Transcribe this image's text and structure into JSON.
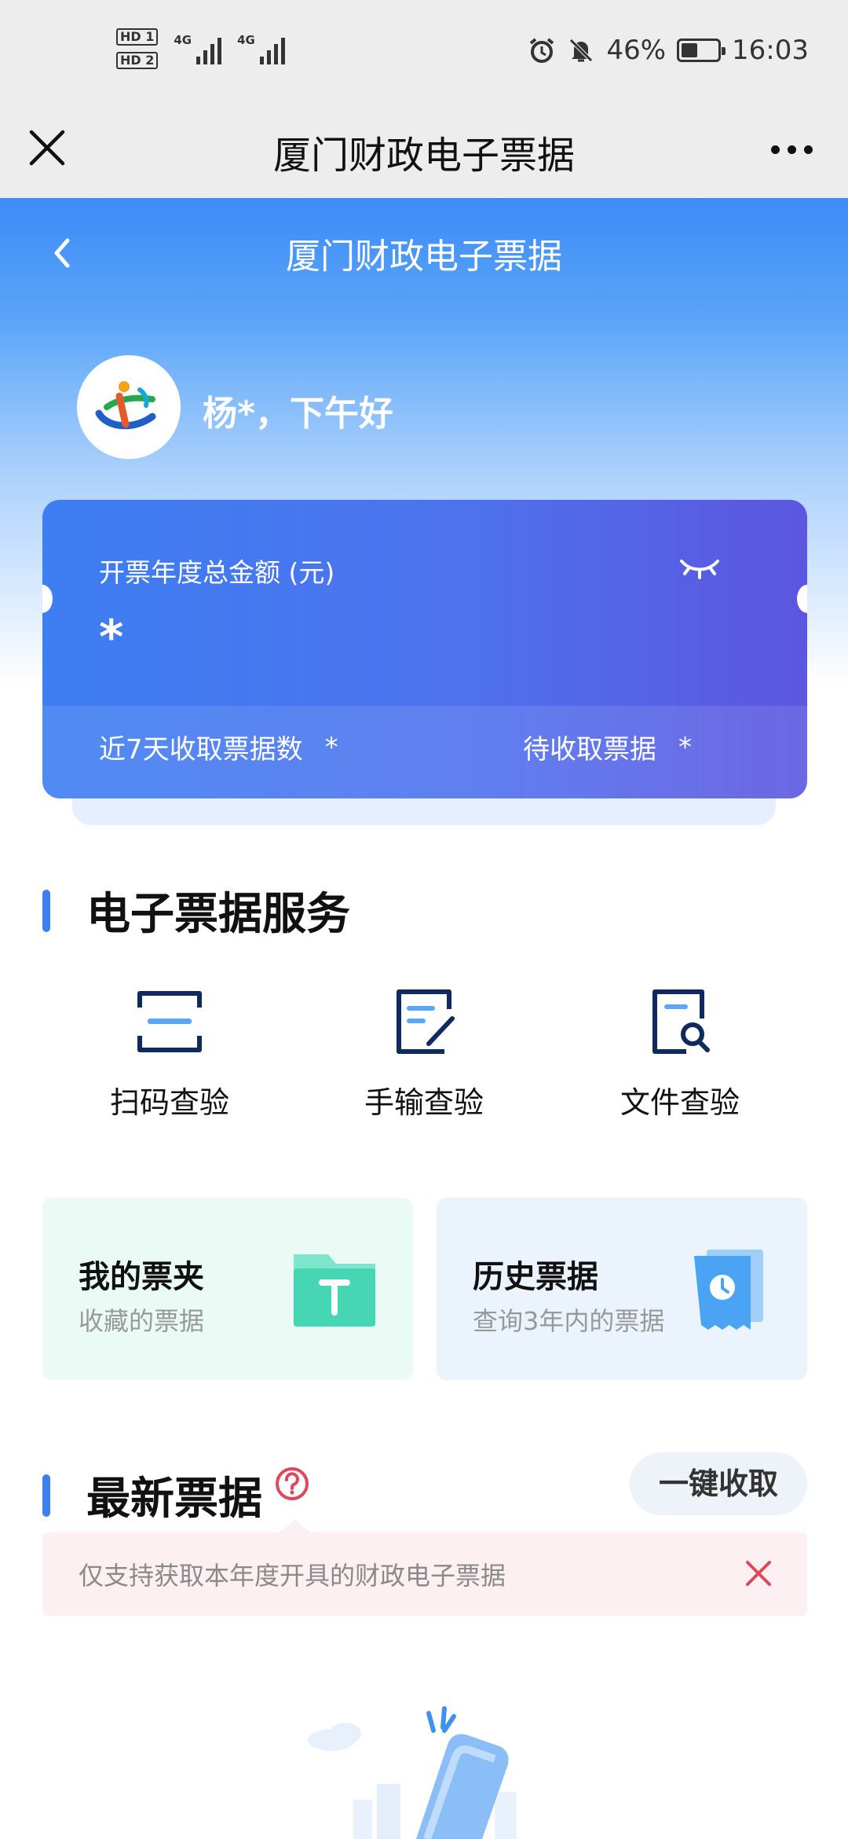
{
  "status_bar": {
    "hd1": "HD 1",
    "hd2": "HD 2",
    "net1": "4G",
    "net2": "4G",
    "battery_percent": "46%",
    "time": "16:03"
  },
  "wx_nav": {
    "title": "厦门财政电子票据"
  },
  "hero": {
    "title": "厦门财政电子票据",
    "greeting": "杨*，下午好"
  },
  "amount_card": {
    "label": "开票年度总金额 (元)",
    "value": "*",
    "recent_label": "近7天收取票据数",
    "recent_value": "*",
    "pending_label": "待收取票据",
    "pending_value": "*"
  },
  "services": {
    "title": "电子票据服务",
    "items": [
      {
        "label": "扫码查验",
        "icon": "scan-icon"
      },
      {
        "label": "手输查验",
        "icon": "edit-doc-icon"
      },
      {
        "label": "文件查验",
        "icon": "file-search-icon"
      }
    ]
  },
  "cards": [
    {
      "title": "我的票夹",
      "subtitle": "收藏的票据",
      "icon": "folder-icon"
    },
    {
      "title": "历史票据",
      "subtitle": "查询3年内的票据",
      "icon": "history-receipt-icon"
    }
  ],
  "latest": {
    "title": "最新票据",
    "collect_button": "一键收取",
    "tip": "仅支持获取本年度开具的财政电子票据"
  },
  "colors": {
    "accent": "#3b7ff2",
    "card_start": "#3d7ef2",
    "card_end": "#5c56e0",
    "teal_card_bg": "#eafbf5",
    "blue_card_bg": "#ebf4fd",
    "tip_bg": "#fdf0f2",
    "danger": "#e0475b"
  }
}
